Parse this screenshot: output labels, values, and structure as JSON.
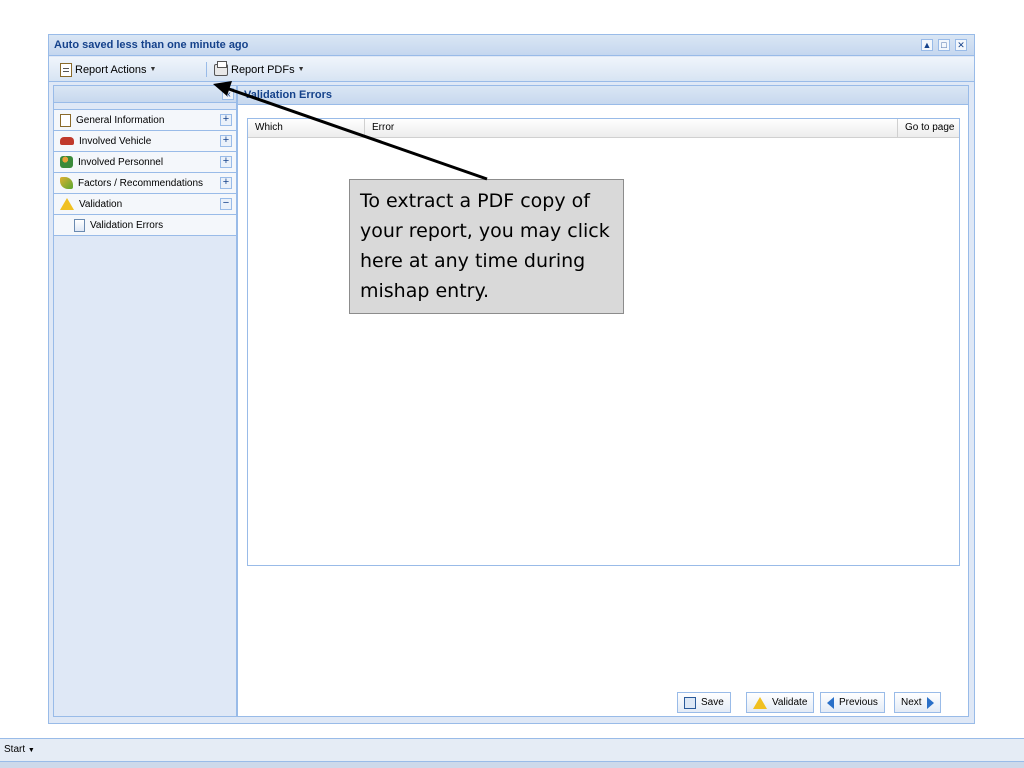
{
  "window": {
    "title": "Auto saved less than one minute ago",
    "controls": [
      "▲",
      "□",
      "✕"
    ]
  },
  "toolbar": {
    "report_actions_label": "Report Actions",
    "report_pdfs_label": "Report PDFs"
  },
  "sidebar": {
    "collapse_glyph": "«",
    "items": [
      {
        "label": "General Information",
        "toggle": "+"
      },
      {
        "label": "Involved Vehicle",
        "toggle": "+"
      },
      {
        "label": "Involved Personnel",
        "toggle": "+"
      },
      {
        "label": "Factors / Recommendations",
        "toggle": "+"
      },
      {
        "label": "Validation",
        "toggle": "−"
      },
      {
        "label": "Validation Errors"
      }
    ]
  },
  "main": {
    "panel_title": "Validation Errors",
    "grid_columns": [
      "Which",
      "Error",
      "Go to page"
    ]
  },
  "footer": {
    "save_label": "Save",
    "validate_label": "Validate",
    "previous_label": "Previous",
    "next_label": "Next"
  },
  "callout": {
    "text": "To extract a PDF copy of your report, you may click here at any time during mishap entry."
  },
  "taskbar": {
    "start_label": "Start"
  },
  "colors": {
    "panel_border": "#99bbe8",
    "panel_bg": "#dfe8f6",
    "title_text": "#15428b"
  }
}
